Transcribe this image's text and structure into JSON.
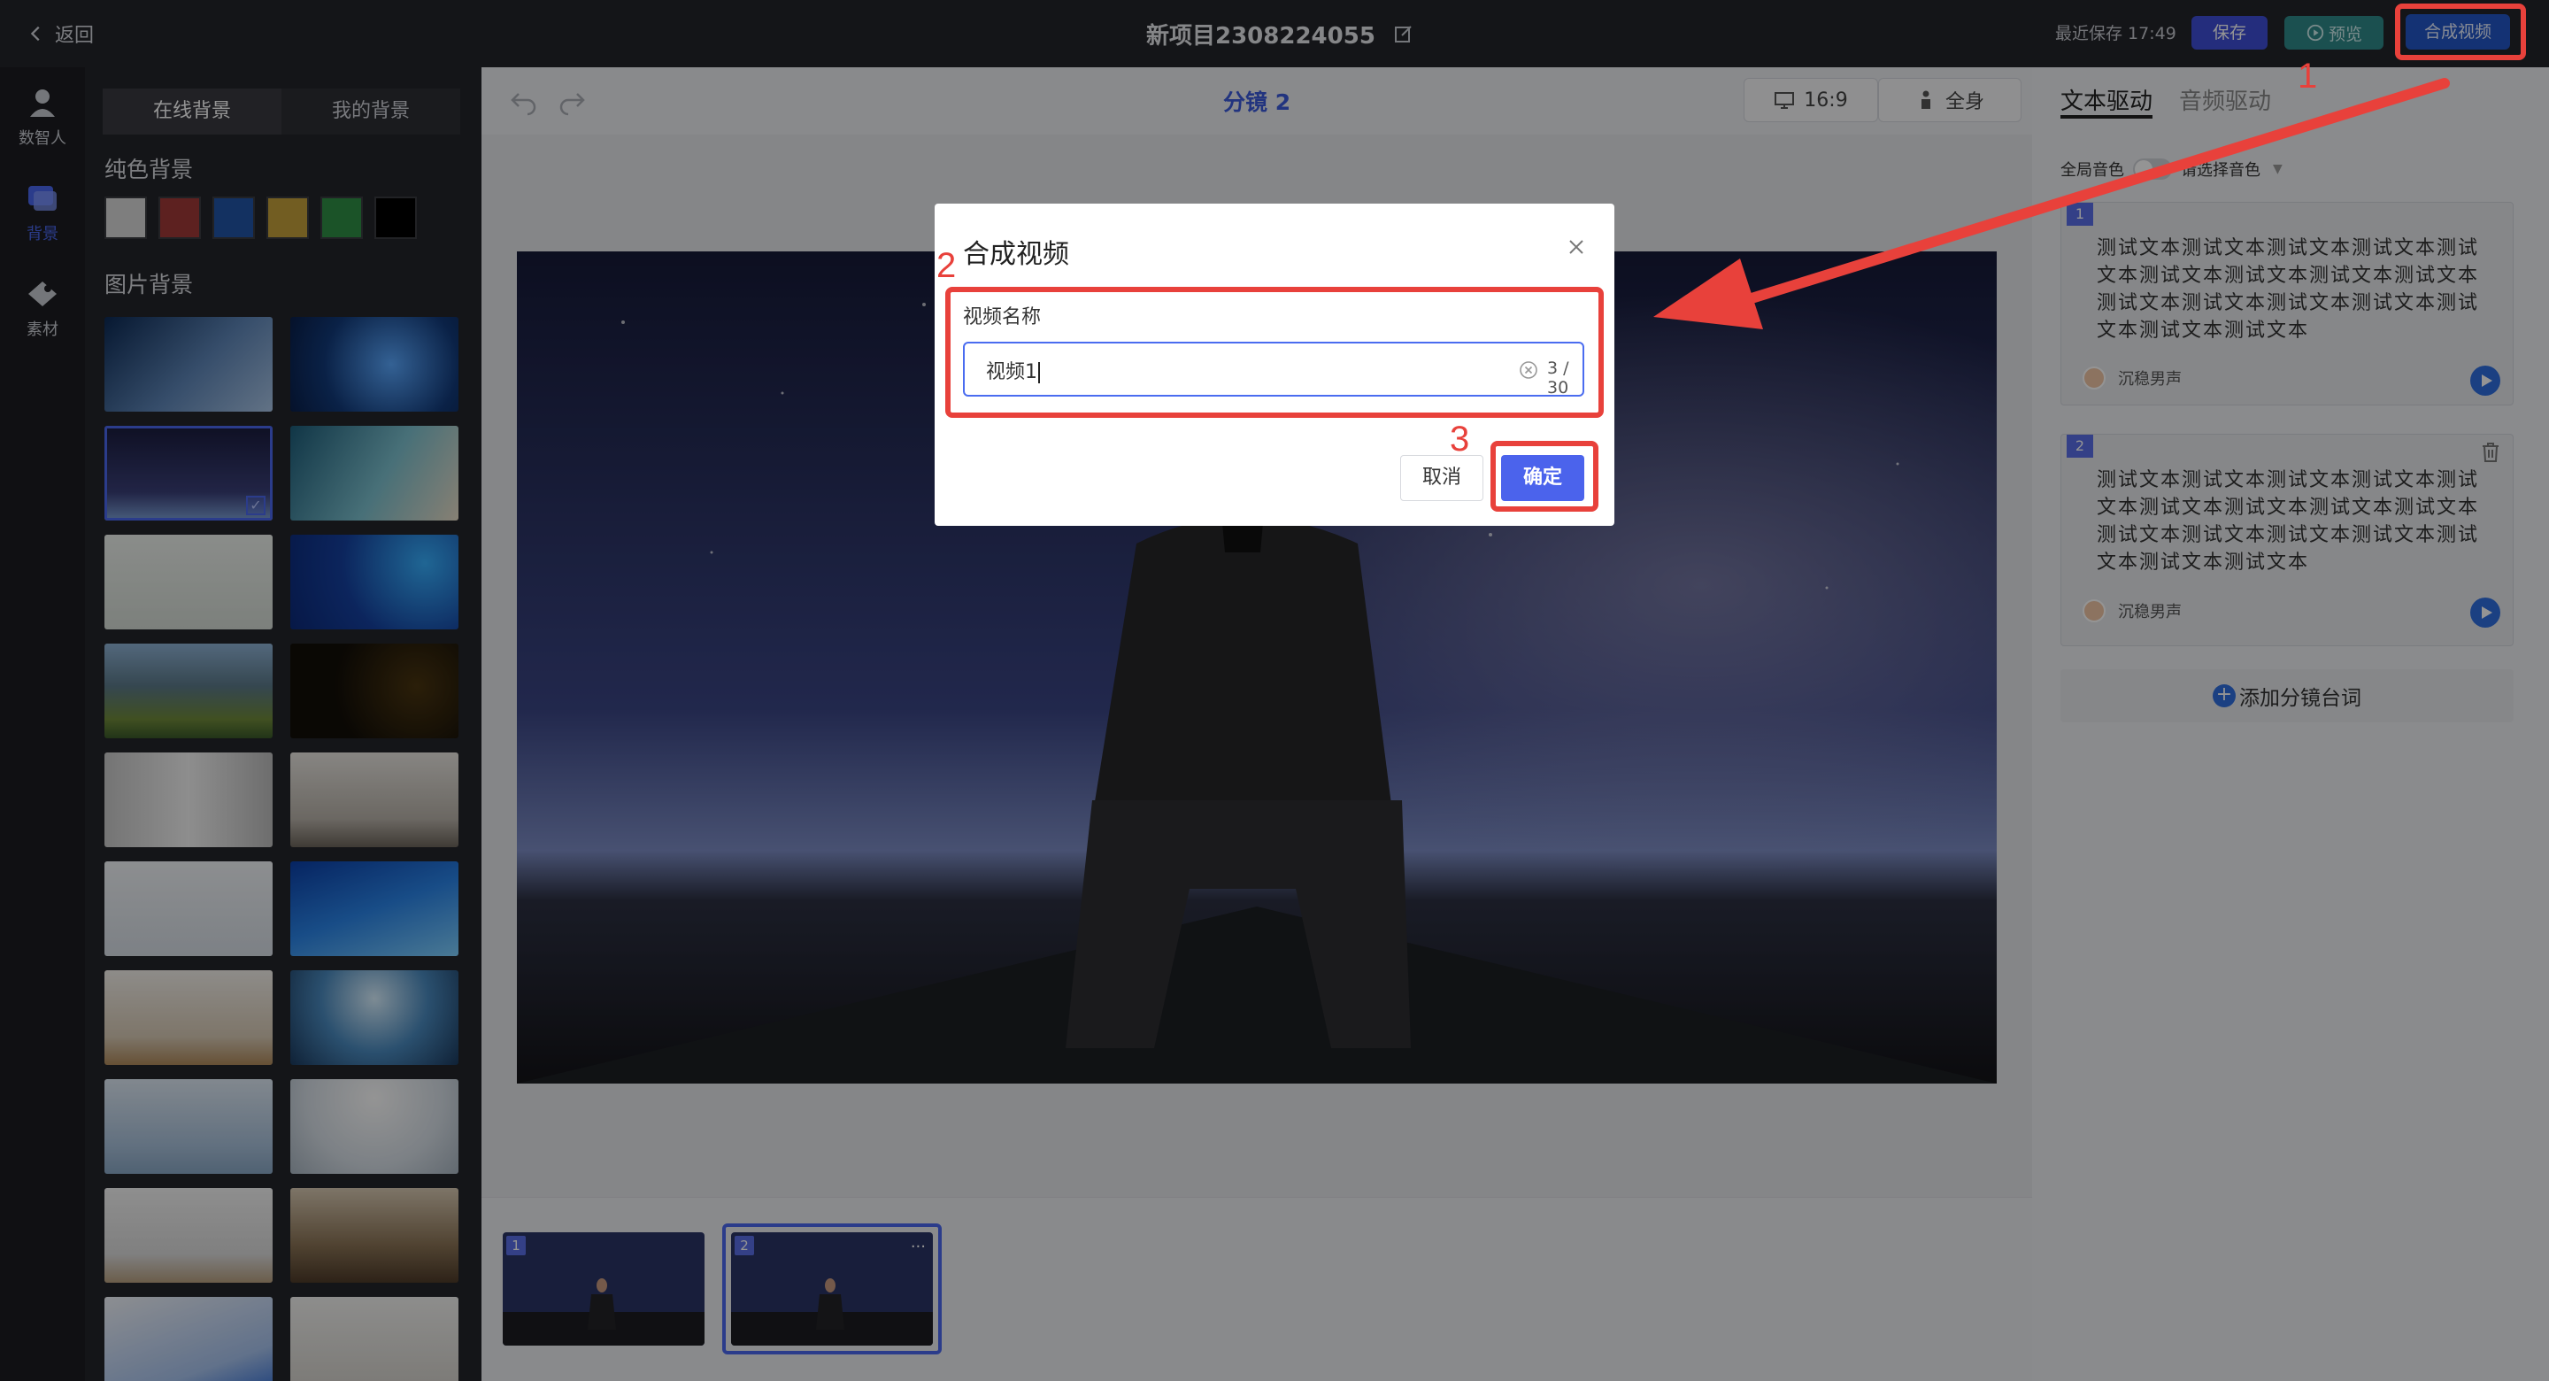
{
  "topbar": {
    "back_label": "返回",
    "project_title": "新项目2308224055",
    "saved_time": "最近保存 17:49",
    "save_label": "保存",
    "preview_label": "预览",
    "compose_label": "合成视频"
  },
  "rail": {
    "items": [
      {
        "label": "数智人",
        "icon": "digital-human-icon"
      },
      {
        "label": "背景",
        "icon": "background-icon"
      },
      {
        "label": "素材",
        "icon": "material-icon"
      }
    ]
  },
  "bg_panel": {
    "tabs": [
      "在线背景",
      "我的背景"
    ],
    "solid_label": "纯色背景",
    "solid_colors": [
      "#d9d9d9",
      "#a03a38",
      "#2255a8",
      "#c4a03c",
      "#2f8f45",
      "#000000"
    ],
    "image_label": "图片背景"
  },
  "canvas": {
    "scene_title": "分镜 2",
    "ratio_label": "16:9",
    "shot_label": "全身"
  },
  "scenes": [
    {
      "num": "1"
    },
    {
      "num": "2",
      "more": "···"
    }
  ],
  "right_panel": {
    "tabs": [
      "文本驱动",
      "音频驱动"
    ],
    "global_voice_label": "全局音色",
    "voice_placeholder": "请选择音色",
    "cards": [
      {
        "num": "1",
        "text": "测试文本测试文本测试文本测试文本测试文本测试文本测试文本测试文本测试文本测试文本测试文本测试文本测试文本测试文本测试文本测试文本",
        "voice": "沉稳男声"
      },
      {
        "num": "2",
        "text": "测试文本测试文本测试文本测试文本测试文本测试文本测试文本测试文本测试文本测试文本测试文本测试文本测试文本测试文本测试文本测试文本",
        "voice": "沉稳男声"
      }
    ],
    "add_label": "添加分镜台词"
  },
  "modal": {
    "title": "合成视频",
    "field_label": "视频名称",
    "input_value": "视频1",
    "counter": "3 / 30",
    "cancel_label": "取消",
    "confirm_label": "确定"
  },
  "annotations": {
    "step1": "1",
    "step2": "2",
    "step3": "3",
    "color": "#e8413b"
  }
}
